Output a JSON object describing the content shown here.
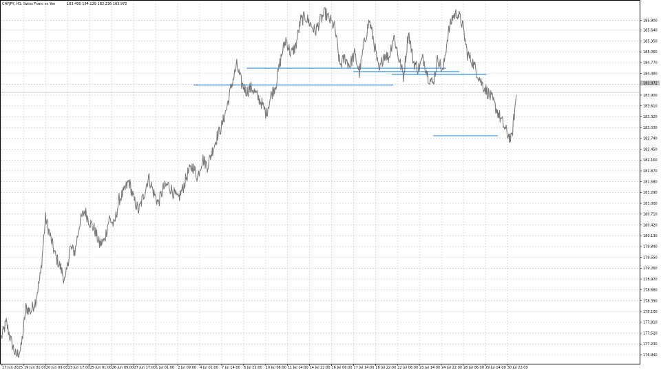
{
  "chart_data": {
    "type": "line",
    "title": "CHFJPY, H1: Swiss Franc vs Yen",
    "ohlc_label": "183.400 184.129 183.236 183.972",
    "colors": {
      "background": "#ffffff",
      "grid": "#c8c8c8",
      "price_line": "#7a7a7a",
      "level_line": "#6aaee0",
      "frame": "#000000",
      "current_price_line": "#c0c0c0",
      "price_marker_bg": "#c0c0c0"
    },
    "grid": true,
    "ylim": [
      176.7,
      186.43
    ],
    "y_ticks": [
      "185.900",
      "185.640",
      "185.350",
      "185.060",
      "184.770",
      "184.480",
      "184.190",
      "183.900",
      "183.610",
      "183.320",
      "183.030",
      "182.740",
      "182.450",
      "182.160",
      "181.870",
      "181.580",
      "181.290",
      "181.000",
      "180.710",
      "180.420",
      "180.130",
      "179.840",
      "179.550",
      "179.260",
      "178.970",
      "178.680",
      "178.390",
      "178.100",
      "177.810",
      "177.520",
      "177.230",
      "176.940"
    ],
    "current_price_marker": "183.972",
    "x_ticks": [
      "17 Jun 2025",
      "19 Jun 01:00",
      "20 Jun 09:00",
      "23 Jun 17:00",
      "25 Jun 01:00",
      "26 Jun 09:00",
      "27 Jun 17:00",
      "1 Jul 01:00",
      "2 Jul 09:00",
      "4 Jul 01:00",
      "7 Jul 14:00",
      "8 Jul 22:00",
      "10 Jul 06:00",
      "11 Jul 14:00",
      "14 Jul 22:00",
      "16 Jul 06:00",
      "17 Jul 14:00",
      "18 Jul 22:00",
      "22 Jul 06:00",
      "23 Jul 14:00",
      "24 Jul 22:00",
      "28 Jul 06:00",
      "29 Jul 14:00",
      "30 Jul 22:00"
    ],
    "series": [
      {
        "values": [
          177.4,
          177.8,
          177.3,
          176.9,
          177.1,
          178.2,
          178.1,
          178.4,
          179.1,
          180.6,
          180.1,
          179.6,
          179.3,
          178.9,
          179.8,
          179.7,
          180.5,
          180.8,
          180.5,
          180.3,
          179.9,
          180.0,
          180.6,
          180.4,
          181.1,
          181.3,
          181.6,
          181.1,
          180.8,
          181.2,
          181.7,
          181.3,
          181.0,
          181.4,
          181.5,
          181.3,
          181.1,
          181.4,
          181.8,
          182.0,
          181.7,
          182.2,
          182.0,
          182.4,
          182.8,
          183.1,
          183.6,
          184.2,
          184.7,
          184.2,
          184.0,
          184.1,
          183.9,
          183.7,
          183.4,
          183.9,
          184.2,
          184.9,
          185.4,
          185.0,
          185.2,
          185.9,
          186.0,
          185.8,
          185.6,
          185.9,
          186.1,
          185.9,
          185.7,
          184.7,
          184.9,
          184.7,
          185.0,
          184.5,
          185.3,
          185.9,
          185.3,
          184.5,
          185.0,
          184.9,
          185.5,
          184.9,
          184.4,
          185.6,
          184.8,
          184.6,
          184.9,
          184.4,
          184.2,
          184.9,
          184.5,
          185.5,
          186.0,
          186.1,
          185.8,
          185.0,
          184.8,
          184.5,
          184.2,
          184.0,
          183.8,
          183.5,
          183.2,
          182.9,
          182.7,
          183.9
        ]
      }
    ],
    "horizontal_levels": [
      {
        "price": 184.62,
        "x_start": 0.385,
        "x_end": 0.697
      },
      {
        "price": 184.53,
        "x_start": 0.552,
        "x_end": 0.718
      },
      {
        "price": 184.45,
        "x_start": 0.612,
        "x_end": 0.76
      },
      {
        "price": 184.17,
        "x_start": 0.302,
        "x_end": 0.614
      },
      {
        "price": 182.81,
        "x_start": 0.677,
        "x_end": 0.778
      }
    ]
  }
}
